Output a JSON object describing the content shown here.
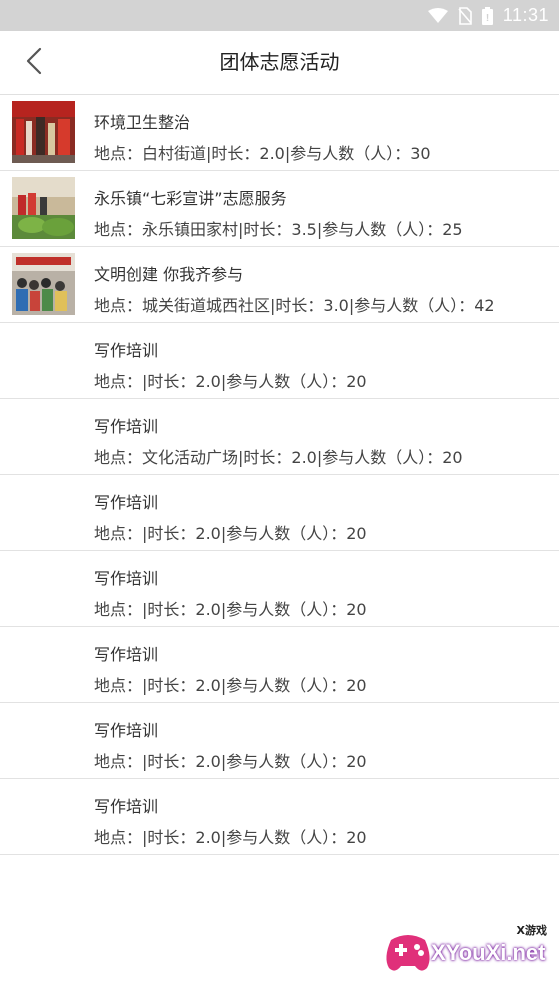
{
  "status_bar": {
    "time": "11:31",
    "icons": [
      "wifi-icon",
      "no-sim-icon",
      "battery-icon"
    ]
  },
  "header": {
    "title": "团体志愿活动",
    "back_icon": "chevron-left-icon"
  },
  "activities": [
    {
      "title": "环境卫生整治",
      "meta": "地点：白村街道|时长：2.0|参与人数（人）：30",
      "has_image": true
    },
    {
      "title": "永乐镇“七彩宣讲”志愿服务",
      "meta": "地点：永乐镇田家村|时长：3.5|参与人数（人）：25",
      "has_image": true
    },
    {
      "title": "文明创建 你我齐参与",
      "meta": "地点：城关街道城西社区|时长：3.0|参与人数（人）：42",
      "has_image": true
    },
    {
      "title": "写作培训",
      "meta": "地点：|时长：2.0|参与人数（人）：20",
      "has_image": false
    },
    {
      "title": "写作培训",
      "meta": "地点：文化活动广场|时长：2.0|参与人数（人）：20",
      "has_image": false
    },
    {
      "title": "写作培训",
      "meta": "地点：|时长：2.0|参与人数（人）：20",
      "has_image": false
    },
    {
      "title": "写作培训",
      "meta": "地点：|时长：2.0|参与人数（人）：20",
      "has_image": false
    },
    {
      "title": "写作培训",
      "meta": "地点：|时长：2.0|参与人数（人）：20",
      "has_image": false
    },
    {
      "title": "写作培训",
      "meta": "地点：|时长：2.0|参与人数（人）：20",
      "has_image": false
    },
    {
      "title": "写作培训",
      "meta": "地点：|时长：2.0|参与人数（人）：20",
      "has_image": false
    }
  ],
  "watermark": {
    "text": "XYouXi.net",
    "small_text": "X游戏"
  },
  "colors": {
    "status_bar": "#d3d3d3",
    "divider": "#e2e2e2",
    "text_primary": "#333333"
  }
}
